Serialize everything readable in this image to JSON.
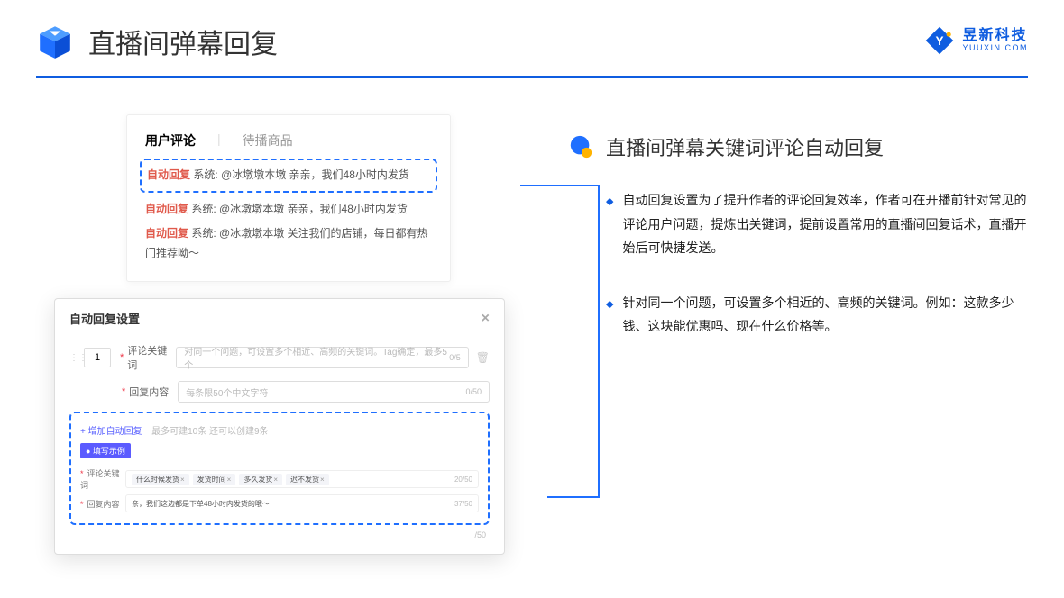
{
  "header": {
    "title": "直播间弹幕回复"
  },
  "logo": {
    "cn": "昱新科技",
    "en": "YUUXIN.COM"
  },
  "comments": {
    "tabs": {
      "active": "用户评论",
      "inactive": "待播商品"
    },
    "items": [
      {
        "tag": "自动回复",
        "text": "系统: @冰墩墩本墩 亲亲，我们48小时内发货"
      },
      {
        "tag": "自动回复",
        "text": "系统: @冰墩墩本墩 亲亲，我们48小时内发货"
      },
      {
        "tag": "自动回复",
        "text": "系统: @冰墩墩本墩 关注我们的店铺，每日都有热门推荐呦～"
      }
    ]
  },
  "settings": {
    "dialog_title": "自动回复设置",
    "index": "1",
    "keyword_label": "评论关键词",
    "keyword_placeholder": "对同一个问题，可设置多个相近、高频的关键词。Tag确定，最多5个",
    "keyword_counter": "0/5",
    "content_label": "回复内容",
    "content_placeholder": "每条限50个中文字符",
    "content_counter": "0/50",
    "add_link": "+ 增加自动回复",
    "add_hint": "最多可建10条 还可以创建9条",
    "example_badge": "● 填写示例",
    "ex_kw_label": "评论关键词",
    "ex_chips": [
      "什么时候发货",
      "发货时间",
      "多久发货",
      "迟不发货"
    ],
    "ex_kw_counter": "20/50",
    "ex_content_label": "回复内容",
    "ex_content_value": "亲，我们这边都是下单48小时内发货的哦～",
    "ex_content_counter": "37/50",
    "bottom_counter": "/50"
  },
  "right": {
    "section_title": "直播间弹幕关键词评论自动回复",
    "bullets": [
      "自动回复设置为了提升作者的评论回复效率，作者可在开播前针对常见的评论用户问题，提炼出关键词，提前设置常用的直播间回复话术，直播开始后可快捷发送。",
      "针对同一个问题，可设置多个相近的、高频的关键词。例如：这款多少钱、这块能优惠吗、现在什么价格等。"
    ]
  }
}
